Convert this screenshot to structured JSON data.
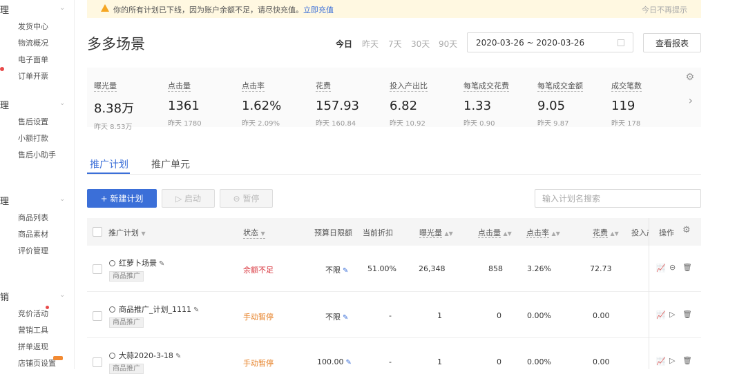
{
  "sidebar": {
    "sections": [
      {
        "title": "理",
        "items": [
          "发货中心",
          "物流概况",
          "电子面单",
          "订单开票"
        ]
      },
      {
        "title": "理",
        "items": [
          "售后设置",
          "小额打款",
          "售后小助手"
        ]
      },
      {
        "title": "理",
        "items": [
          "商品列表",
          "商品素材",
          "评价管理"
        ]
      },
      {
        "title": "销",
        "items": [
          "竞价活动",
          "营销工具",
          "拼单返现",
          "店铺页设置"
        ]
      }
    ]
  },
  "banner": {
    "message": "你的所有计划已下线，因为账户余额不足，请尽快充值。",
    "link": "立即充值",
    "dismiss": "今日不再提示"
  },
  "page": {
    "title": "多多场景"
  },
  "range_buttons": [
    "今日",
    "昨天",
    "7天",
    "30天",
    "90天"
  ],
  "active_range": "今日",
  "date_range": "2020-03-26 ~ 2020-03-26",
  "report_button": "查看报表",
  "stats": [
    {
      "label": "曝光量",
      "value": "8.38万",
      "prev": "昨天 8.53万"
    },
    {
      "label": "点击量",
      "value": "1361",
      "prev": "昨天 1780"
    },
    {
      "label": "点击率",
      "value": "1.62%",
      "prev": "昨天 2.09%"
    },
    {
      "label": "花费",
      "value": "157.93",
      "prev": "昨天 160.84"
    },
    {
      "label": "投入产出比",
      "value": "6.82",
      "prev": "昨天 10.92"
    },
    {
      "label": "每笔成交花费",
      "value": "1.33",
      "prev": "昨天 0.90"
    },
    {
      "label": "每笔成交金额",
      "value": "9.05",
      "prev": "昨天 9.87"
    },
    {
      "label": "成交笔数",
      "value": "119",
      "prev": "昨天 178"
    }
  ],
  "tabs": [
    "推广计划",
    "推广单元"
  ],
  "toolbar": {
    "new_plan": "+ 新建计划",
    "start": "启动",
    "pause": "暂停",
    "search_placeholder": "输入计划名搜索"
  },
  "table": {
    "columns": [
      "推广计划",
      "状态",
      "预算日限额",
      "当前折扣",
      "曝光量",
      "点击量",
      "点击率",
      "花费",
      "投入产",
      "操作"
    ],
    "rows": [
      {
        "name": "红萝卜场景",
        "tag": "商品推广",
        "status": "余额不足",
        "budget": "不限",
        "discount": "51.00%",
        "impressions": "26,348",
        "clicks": "858",
        "ctr": "3.26%",
        "cost": "72.73"
      },
      {
        "name": "商品推广_计划_1111",
        "tag": "商品推广",
        "status": "手动暂停",
        "budget": "不限",
        "discount": "-",
        "impressions": "1",
        "clicks": "0",
        "ctr": "0.00%",
        "cost": "0.00"
      },
      {
        "name": "大蒜2020-3-18",
        "tag": "商品推广",
        "status": "手动暂停",
        "budget": "100.00",
        "discount": "-",
        "impressions": "1",
        "clicks": "0",
        "ctr": "0.00%",
        "cost": "0.00"
      }
    ]
  },
  "colors": {
    "primary": "#3b6fd8",
    "warning_bg": "#fff8e1",
    "status_red": "#d9363e",
    "status_orange": "#e67e22"
  }
}
